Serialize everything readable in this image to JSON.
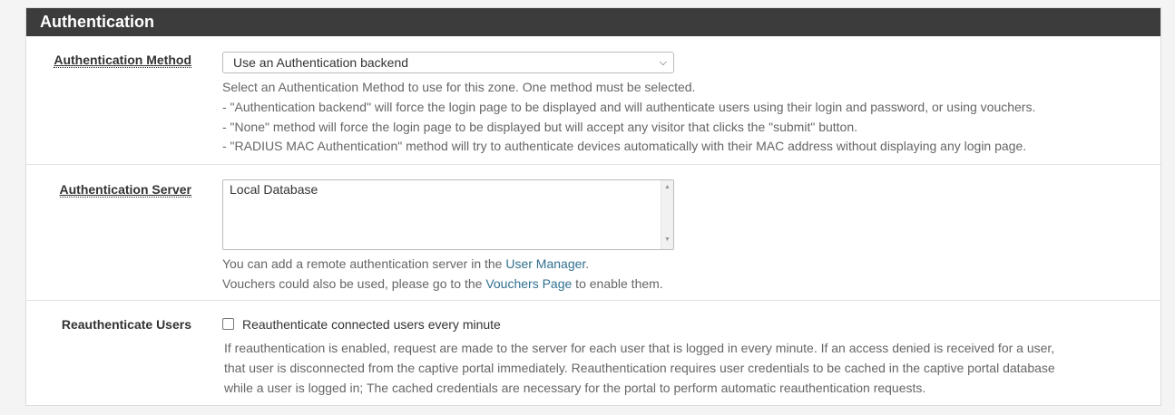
{
  "panel": {
    "title": "Authentication"
  },
  "auth_method": {
    "label": "Authentication Method",
    "selected": "Use an Authentication backend",
    "help": [
      "Select an Authentication Method to use for this zone. One method must be selected.",
      "- \"Authentication backend\" will force the login page to be displayed and will authenticate users using their login and password, or using vouchers.",
      "- \"None\" method will force the login page to be displayed but will accept any visitor that clicks the \"submit\" button.",
      "- \"RADIUS MAC Authentication\" method will try to authenticate devices automatically with their MAC address without displaying any login page."
    ]
  },
  "auth_server": {
    "label": "Authentication Server",
    "options": [
      "Local Database"
    ],
    "help1_prefix": "You can add a remote authentication server in the ",
    "help1_link": "User Manager",
    "help1_suffix": ".",
    "help2_prefix": "Vouchers could also be used, please go to the ",
    "help2_link": "Vouchers Page",
    "help2_suffix": " to enable them."
  },
  "reauth": {
    "label": "Reauthenticate Users",
    "checkbox_label": "Reauthenticate connected users every minute",
    "checked": false,
    "help": [
      "If reauthentication is enabled, request are made to the server for each user that is logged in every minute. If an access denied is received for a user,",
      "that user is disconnected from the captive portal immediately. Reauthentication requires user credentials to be cached in the captive portal database",
      "while a user is logged in; The cached credentials are necessary for the portal to perform automatic reauthentication requests."
    ]
  }
}
